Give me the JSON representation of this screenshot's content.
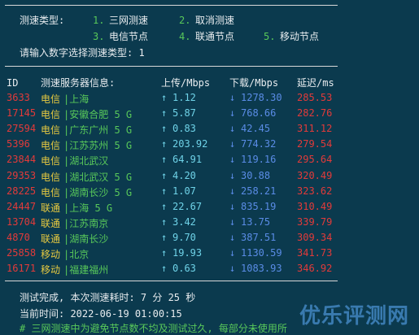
{
  "menu": {
    "type_label": "测速类型:",
    "options": [
      {
        "num": "1.",
        "label": "三网测速"
      },
      {
        "num": "2.",
        "label": "取消测速"
      },
      {
        "num": "3.",
        "label": "电信节点"
      },
      {
        "num": "4.",
        "label": "联通节点"
      },
      {
        "num": "5.",
        "label": "移动节点"
      }
    ],
    "prompt": "请输入数字选择测速类型: 1"
  },
  "table": {
    "headers": {
      "id": "ID",
      "server": "测速服务器信息:",
      "upload": "上传/Mbps",
      "download": "下载/Mbps",
      "latency": "延迟/ms"
    },
    "arrow_up": "↑",
    "arrow_down": "↓",
    "rows": [
      {
        "id": "3633",
        "isp": "电信",
        "loc": "|上海",
        "up": "1.12",
        "down": "1278.30",
        "lat": "285.53"
      },
      {
        "id": "17145",
        "isp": "电信",
        "loc": "|安徽合肥 5 G",
        "up": "5.87",
        "down": "768.66",
        "lat": "282.76"
      },
      {
        "id": "27594",
        "isp": "电信",
        "loc": "|广东广州 5 G",
        "up": "0.83",
        "down": "42.45",
        "lat": "311.12"
      },
      {
        "id": "5396",
        "isp": "电信",
        "loc": "|江苏苏州 5 G",
        "up": "203.92",
        "down": "774.32",
        "lat": "279.54"
      },
      {
        "id": "23844",
        "isp": "电信",
        "loc": "|湖北武汉",
        "up": "64.91",
        "down": "119.16",
        "lat": "295.64"
      },
      {
        "id": "29353",
        "isp": "电信",
        "loc": "|湖北武汉 5 G",
        "up": "4.20",
        "down": "30.88",
        "lat": "320.49"
      },
      {
        "id": "28225",
        "isp": "电信",
        "loc": "|湖南长沙 5 G",
        "up": "1.07",
        "down": "258.21",
        "lat": "323.62"
      },
      {
        "id": "24447",
        "isp": "联通",
        "loc": "|上海 5 G",
        "up": "22.67",
        "down": "835.19",
        "lat": "310.49"
      },
      {
        "id": "13704",
        "isp": "联通",
        "loc": "|江苏南京",
        "up": "3.42",
        "down": "13.75",
        "lat": "339.79"
      },
      {
        "id": "4870",
        "isp": "联通",
        "loc": "|湖南长沙",
        "up": "9.70",
        "down": "387.51",
        "lat": "309.34"
      },
      {
        "id": "25858",
        "isp": "移动",
        "loc": "|北京",
        "up": "19.93",
        "down": "1130.59",
        "lat": "341.73"
      },
      {
        "id": "16171",
        "isp": "移动",
        "loc": "|福建福州",
        "up": "0.63",
        "down": "1083.93",
        "lat": "346.92"
      }
    ]
  },
  "footer": {
    "done": "测试完成, 本次测速耗时: 7 分 25 秒",
    "time": "当前时间: 2022-06-19 01:00:15",
    "note": "# 三网测速中为避免节点数不均及测试过久, 每部分未使用所"
  },
  "watermark": "优乐评测网",
  "colors": {
    "background": "#0b3a4e",
    "green": "#58c85a",
    "red": "#e23a3a",
    "yellow": "#e6c940",
    "cyan": "#6fd3e8",
    "blue": "#5a8ce6"
  }
}
